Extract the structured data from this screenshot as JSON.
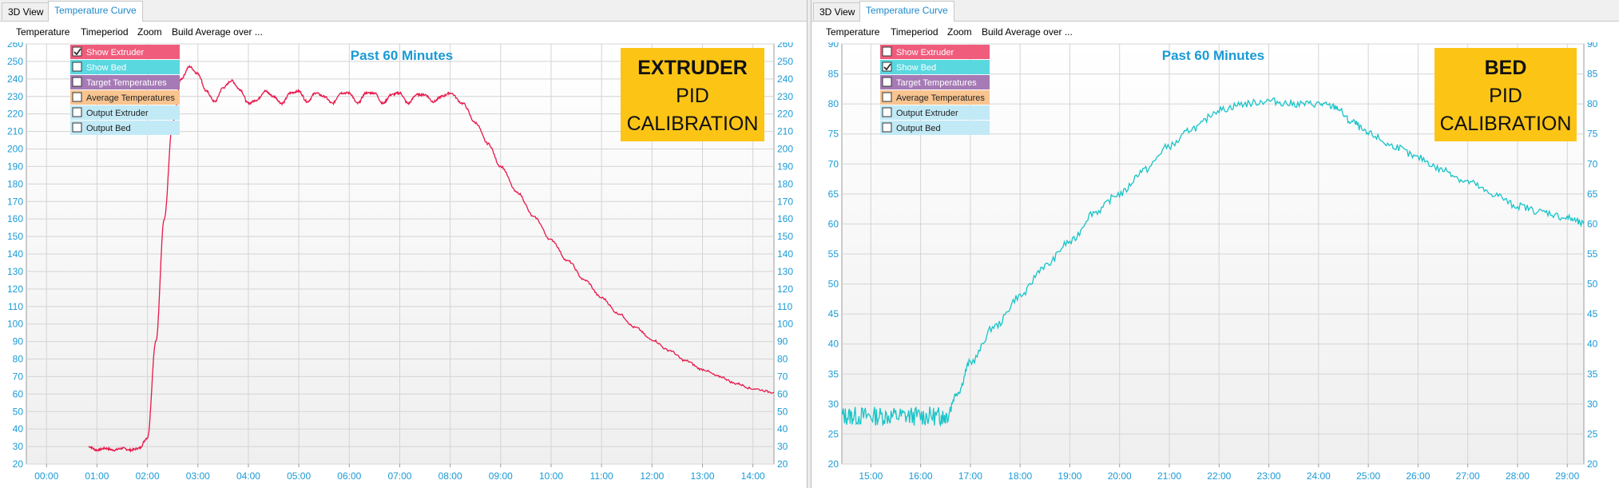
{
  "panels": [
    {
      "tabs": [
        {
          "label": "3D View",
          "active": false
        },
        {
          "label": "Temperature Curve",
          "active": true
        }
      ],
      "menu": [
        "Temperature",
        "Timeperiod",
        "Zoom",
        "Build Average over ..."
      ],
      "legend": [
        {
          "label": "Show Extruder",
          "checked": true,
          "color": "#f05c7c"
        },
        {
          "label": "Show Bed",
          "checked": false,
          "color": "#5ad8e0"
        },
        {
          "label": "Target Temperatures",
          "checked": false,
          "color": "#a57ab5"
        },
        {
          "label": "Average Temperatures",
          "checked": false,
          "color": "#f8c490"
        },
        {
          "label": "Output Extruder",
          "checked": false,
          "color": "#c2eaf6"
        },
        {
          "label": "Output Bed",
          "checked": false,
          "color": "#c2eaf6"
        }
      ],
      "badge": [
        "EXTRUDER",
        "PID",
        "CALIBRATION"
      ],
      "chart_data": {
        "type": "line",
        "title": "Past 60 Minutes",
        "xlabel": "",
        "ylabel": "",
        "x_ticks": [
          "00:00",
          "01:00",
          "02:00",
          "03:00",
          "04:00",
          "05:00",
          "06:00",
          "07:00",
          "08:00",
          "09:00",
          "10:00",
          "11:00",
          "12:00",
          "13:00",
          "14:00"
        ],
        "xlim": [
          "23:36",
          "14:25"
        ],
        "ylim": [
          20,
          260
        ],
        "y_ticks": [
          20,
          30,
          40,
          50,
          60,
          70,
          80,
          90,
          100,
          110,
          120,
          130,
          140,
          150,
          160,
          170,
          180,
          190,
          200,
          210,
          220,
          230,
          240,
          250,
          260
        ],
        "grid": true,
        "line_color": "#e8174a",
        "series": [
          {
            "x": [
              "00:50",
              "01:00",
              "01:10",
              "01:20",
              "01:30",
              "01:40",
              "01:50",
              "02:00",
              "02:10",
              "02:20",
              "02:30",
              "02:40",
              "02:50",
              "03:00",
              "03:10",
              "03:20",
              "03:30",
              "03:40",
              "03:50",
              "04:00",
              "04:10",
              "04:20",
              "04:30",
              "04:40",
              "04:50",
              "05:00",
              "05:10",
              "05:20",
              "05:30",
              "05:40",
              "05:50",
              "06:00",
              "06:10",
              "06:20",
              "06:30",
              "06:40",
              "06:50",
              "07:00",
              "07:10",
              "07:20",
              "07:30",
              "07:40",
              "07:50",
              "08:00",
              "08:15",
              "08:30",
              "08:45",
              "09:00",
              "09:20",
              "09:40",
              "10:00",
              "10:20",
              "10:40",
              "11:00",
              "11:20",
              "11:40",
              "12:00",
              "12:20",
              "12:40",
              "13:00",
              "13:20",
              "13:40",
              "14:00",
              "14:25"
            ],
            "values": [
              30,
              28,
              29,
              28,
              29,
              28,
              29,
              35,
              90,
              160,
              215,
              240,
              247,
              243,
              233,
              227,
              235,
              239,
              234,
              226,
              228,
              233,
              230,
              226,
              232,
              233,
              227,
              232,
              230,
              226,
              232,
              232,
              226,
              232,
              232,
              226,
              231,
              232,
              226,
              231,
              231,
              227,
              230,
              232,
              226,
              215,
              203,
              190,
              175,
              161,
              148,
              136,
              125,
              115,
              106,
              98,
              91,
              85,
              79,
              74,
              70,
              66,
              63,
              61
            ]
          }
        ]
      }
    },
    {
      "tabs": [
        {
          "label": "3D View",
          "active": false
        },
        {
          "label": "Temperature Curve",
          "active": true
        }
      ],
      "menu": [
        "Temperature",
        "Timeperiod",
        "Zoom",
        "Build Average over ..."
      ],
      "legend": [
        {
          "label": "Show Extruder",
          "checked": false,
          "color": "#f05c7c"
        },
        {
          "label": "Show Bed",
          "checked": true,
          "color": "#5ad8e0"
        },
        {
          "label": "Target Temperatures",
          "checked": false,
          "color": "#a57ab5"
        },
        {
          "label": "Average Temperatures",
          "checked": false,
          "color": "#f8c490"
        },
        {
          "label": "Output Extruder",
          "checked": false,
          "color": "#c2eaf6"
        },
        {
          "label": "Output Bed",
          "checked": false,
          "color": "#c2eaf6"
        }
      ],
      "badge": [
        "BED",
        "PID",
        "CALIBRATION"
      ],
      "chart_data": {
        "type": "line",
        "title": "Past 60 Minutes",
        "xlabel": "",
        "ylabel": "",
        "x_ticks": [
          "15:00",
          "16:00",
          "17:00",
          "18:00",
          "19:00",
          "20:00",
          "21:00",
          "22:00",
          "23:00",
          "24:00",
          "25:00",
          "26:00",
          "27:00",
          "28:00",
          "29:00"
        ],
        "xlim": [
          "14:25",
          "29:20"
        ],
        "ylim": [
          20,
          90
        ],
        "y_ticks": [
          20,
          25,
          30,
          35,
          40,
          45,
          50,
          55,
          60,
          65,
          70,
          75,
          80,
          85,
          90
        ],
        "grid": true,
        "line_color": "#17c4c8",
        "series": [
          {
            "x": [
              "14:25",
              "14:40",
              "15:00",
              "15:20",
              "15:40",
              "16:00",
              "16:20",
              "16:30",
              "16:45",
              "17:00",
              "17:30",
              "18:00",
              "18:30",
              "19:00",
              "19:30",
              "20:00",
              "20:30",
              "21:00",
              "21:30",
              "22:00",
              "22:30",
              "23:00",
              "23:30",
              "24:00",
              "24:20",
              "24:40",
              "25:00",
              "25:30",
              "26:00",
              "26:30",
              "27:00",
              "27:30",
              "28:00",
              "28:30",
              "29:00",
              "29:20"
            ],
            "values": [
              28,
              28,
              28,
              28,
              28,
              28,
              28,
              28,
              32,
              37,
              43,
              48,
              53,
              57,
              62,
              65,
              69,
              73,
              76,
              79,
              80,
              80.5,
              80,
              80,
              79.5,
              77,
              75,
              73,
              71,
              69,
              67,
              65,
              63,
              62,
              61,
              60
            ]
          }
        ]
      }
    }
  ]
}
